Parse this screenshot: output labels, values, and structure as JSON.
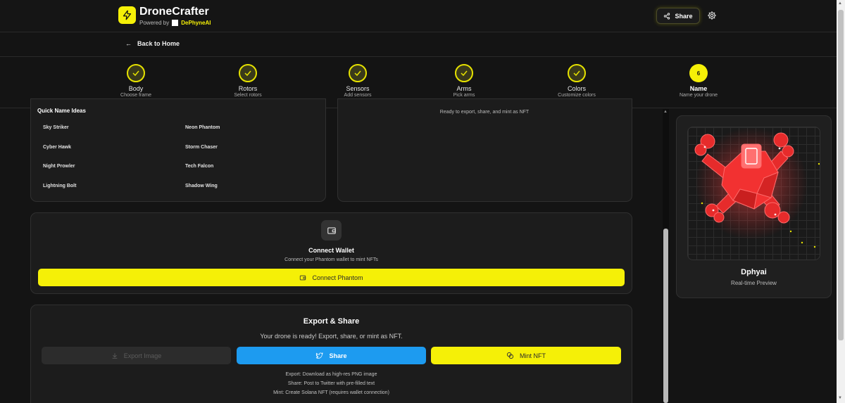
{
  "header": {
    "brand": "DroneCrafter",
    "powered_by": "Powered by",
    "company": "DePhyneAI",
    "share_label": "Share"
  },
  "nav": {
    "back_label": "Back to Home"
  },
  "steps": [
    {
      "label": "Body",
      "sub": "Choose frame",
      "state": "done"
    },
    {
      "label": "Rotors",
      "sub": "Select rotors",
      "state": "done"
    },
    {
      "label": "Sensors",
      "sub": "Add sensors",
      "state": "done"
    },
    {
      "label": "Arms",
      "sub": "Pick arms",
      "state": "done"
    },
    {
      "label": "Colors",
      "sub": "Customize colors",
      "state": "done"
    },
    {
      "label": "Name",
      "sub": "Name your drone",
      "state": "active",
      "number": "6"
    }
  ],
  "quick_names": {
    "title": "Quick Name Ideas",
    "items": [
      "Sky Striker",
      "Neon Phantom",
      "Cyber Hawk",
      "Storm Chaser",
      "Night Prowler",
      "Tech Falcon",
      "Lightning Bolt",
      "Shadow Wing"
    ]
  },
  "summary": {
    "ready_text": "Ready to export, share, and mint as NFT"
  },
  "wallet": {
    "title": "Connect Wallet",
    "subtitle": "Connect your Phantom wallet to mint NFTs",
    "button": "Connect Phantom"
  },
  "export": {
    "title": "Export & Share",
    "subtitle": "Your drone is ready! Export, share, or mint as NFT.",
    "export_button": "Export Image",
    "share_button": "Share",
    "mint_button": "Mint NFT",
    "notes": [
      "Export: Download as high-res PNG image",
      "Share: Post to Twitter with pre-filled text",
      "Mint: Create Solana NFT (requires wallet connection)"
    ]
  },
  "preview": {
    "name": "Dphyai",
    "subtitle": "Real-time Preview"
  },
  "colors": {
    "accent": "#f5f007",
    "twitter": "#1d9bf0",
    "drone": "#ff3b3b"
  }
}
